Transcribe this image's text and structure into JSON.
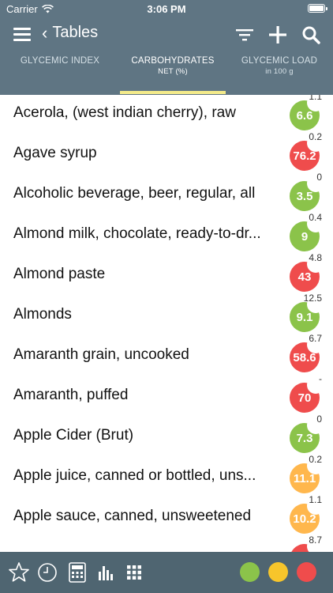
{
  "status_bar": {
    "carrier": "Carrier",
    "time": "3:06 PM"
  },
  "nav": {
    "back_label": "Tables"
  },
  "tabs": [
    {
      "label": "GLYCEMIC INDEX",
      "sub": ""
    },
    {
      "label": "CARBOHYDRATES",
      "sub": "NET (%)"
    },
    {
      "label": "GLYCEMIC LOAD",
      "sub": "in 100 g"
    }
  ],
  "colors": {
    "header": "#5f7583",
    "toolbar": "#4f6571",
    "green": "#8bc34a",
    "red": "#ef4c4c",
    "orange": "#ffb74d",
    "yellow": "#f7c52b",
    "indicator": "#f3ea8a"
  },
  "items": [
    {
      "name": "Acerola, (west indian cherry), raw",
      "value": "6.6",
      "load": "1.1",
      "color": "green"
    },
    {
      "name": "Agave syrup",
      "value": "76.2",
      "load": "0.2",
      "color": "red"
    },
    {
      "name": "Alcoholic beverage, beer, regular, all",
      "value": "3.5",
      "load": "0",
      "color": "green"
    },
    {
      "name": "Almond milk, chocolate, ready-to-dr...",
      "value": "9",
      "load": "0.4",
      "color": "green"
    },
    {
      "name": "Almond paste",
      "value": "43",
      "load": "4.8",
      "color": "red"
    },
    {
      "name": "Almonds",
      "value": "9.1",
      "load": "12.5",
      "color": "green"
    },
    {
      "name": "Amaranth grain, uncooked",
      "value": "58.6",
      "load": "6.7",
      "color": "red"
    },
    {
      "name": "Amaranth, puffed",
      "value": "70",
      "load": "-",
      "color": "red"
    },
    {
      "name": "Apple Cider (Brut)",
      "value": "7.3",
      "load": "0",
      "color": "green"
    },
    {
      "name": "Apple juice, canned or bottled, uns...",
      "value": "11.1",
      "load": "0.2",
      "color": "orange"
    },
    {
      "name": "Apple sauce, canned, unsweetened",
      "value": "10.2",
      "load": "1.1",
      "color": "orange"
    },
    {
      "name": "",
      "value": "",
      "load": "8.7",
      "color": "red"
    }
  ],
  "toolbar": {
    "icons": [
      "star-icon",
      "clock-icon",
      "calculator-icon",
      "bar-chart-icon",
      "grid-icon"
    ],
    "filters": [
      "green",
      "yellow",
      "red"
    ]
  }
}
